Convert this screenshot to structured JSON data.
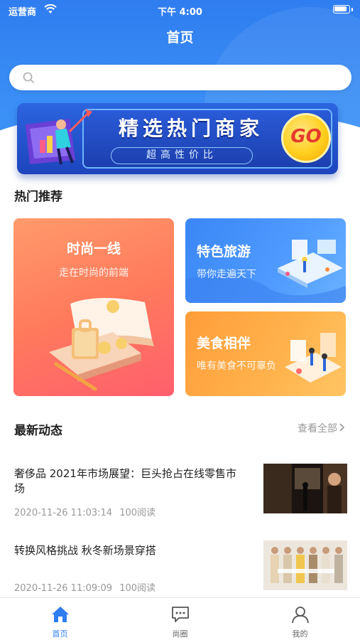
{
  "status_bar": {
    "carrier": "运营商",
    "time": "下午 4:00"
  },
  "header": {
    "title": "首页"
  },
  "search": {
    "placeholder": "",
    "icon": "search-icon"
  },
  "banner": {
    "title": "精选热门商家",
    "subtitle": "超高性价比",
    "badge": "GO"
  },
  "hot": {
    "title": "热门推荐",
    "cards": [
      {
        "title": "时尚一线",
        "subtitle": "走在时尚的前端"
      },
      {
        "title": "特色旅游",
        "subtitle": "带你走遍天下"
      },
      {
        "title": "美食相伴",
        "subtitle": "唯有美食不可辜负"
      }
    ]
  },
  "latest": {
    "title": "最新动态",
    "see_all": "查看全部",
    "items": [
      {
        "title": "奢侈品 2021年市场展望：巨头抢占在线零售市场",
        "date": "2020-11-26 11:03:14",
        "reads": "100阅读"
      },
      {
        "title": "转换风格挑战 秋冬新场景穿搭",
        "date": "2020-11-26 11:09:09",
        "reads": "100阅读"
      }
    ]
  },
  "tabbar": {
    "tabs": [
      {
        "label": "首页",
        "icon": "home-icon",
        "active": true
      },
      {
        "label": "尚圈",
        "icon": "chat-icon",
        "active": false
      },
      {
        "label": "我的",
        "icon": "profile-icon",
        "active": false
      }
    ]
  },
  "colors": {
    "primary": "#2f7df0",
    "fashion": "#ff6f61",
    "travel": "#4a94fb",
    "food": "#ffac45",
    "muted": "#999999"
  }
}
